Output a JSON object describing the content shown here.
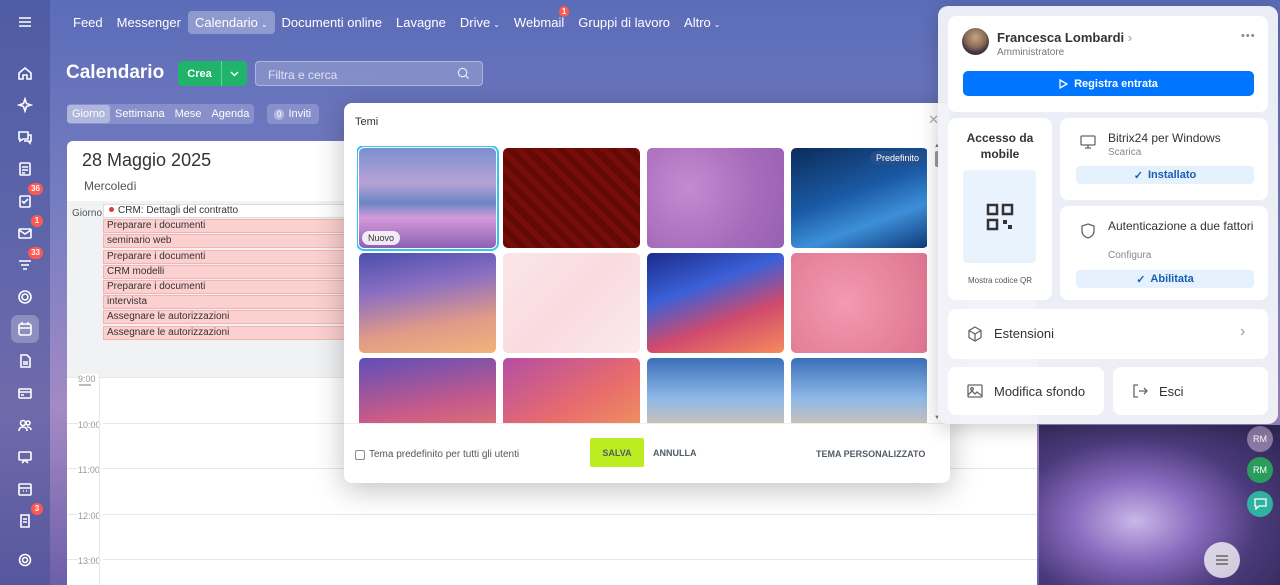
{
  "nav": {
    "items": [
      {
        "label": "Feed",
        "active": false,
        "caret": false
      },
      {
        "label": "Messenger",
        "active": false,
        "caret": false
      },
      {
        "label": "Calendario",
        "active": true,
        "caret": true
      },
      {
        "label": "Documenti online",
        "active": false,
        "caret": false
      },
      {
        "label": "Lavagne",
        "active": false,
        "caret": false
      },
      {
        "label": "Drive",
        "active": false,
        "caret": true
      },
      {
        "label": "Webmail",
        "active": false,
        "caret": false,
        "badge": "1"
      },
      {
        "label": "Gruppi di lavoro",
        "active": false,
        "caret": false
      },
      {
        "label": "Altro",
        "active": false,
        "caret": true
      }
    ]
  },
  "sidebar": {
    "badges": {
      "tasks": "36",
      "mail": "1",
      "feed": "33",
      "approvals": "3"
    }
  },
  "calendar": {
    "title": "Calendario",
    "create_label": "Crea",
    "search_placeholder": "Filtra e cerca",
    "views": [
      "Giorno",
      "Settimana",
      "Mese",
      "Agenda"
    ],
    "active_view": "Giorno",
    "invites_count": "0",
    "invites_label": "Inviti",
    "date": "28 Maggio 2025",
    "weekday": "Mercoledì",
    "allday_label": "Giorno",
    "events": [
      "CRM: Dettagli del contratto",
      "Preparare i documenti",
      "seminario web",
      "Preparare i documenti",
      "CRM modelli",
      "Preparare i documenti",
      "intervista",
      "Assegnare le autorizzazioni",
      "Assegnare le autorizzazioni"
    ],
    "hours": [
      "9:00",
      "10:00",
      "11:00",
      "12:00",
      "13:00"
    ]
  },
  "themes_modal": {
    "title": "Temi",
    "tag_new": "Nuovo",
    "tag_default": "Predefinito",
    "checkbox_label": "Tema predefinito per tutti gli utenti",
    "save": "SALVA",
    "cancel": "ANNULLA",
    "custom": "TEMA PERSONALIZZATO"
  },
  "profile_panel": {
    "user_name": "Francesca Lombardi",
    "user_role": "Amministratore",
    "checkin": "Registra entrata",
    "mobile_title": "Accesso da mobile",
    "qr_label": "Mostra codice QR",
    "windows_title": "Bitrix24 per Windows",
    "windows_sub": "Scarica",
    "windows_btn": "Installato",
    "twofa_title": "Autenticazione a due fattori",
    "twofa_sub": "Configura",
    "twofa_btn": "Abilitata",
    "extensions": "Estensioni",
    "change_bg": "Modifica sfondo",
    "logout": "Esci"
  },
  "right_rail": {
    "initials_1": "RM",
    "initials_2": "RM"
  },
  "colors": {
    "accent": "#0075ff",
    "create": "#1fb46a",
    "save": "#bbed21",
    "badge": "#ff5752"
  }
}
